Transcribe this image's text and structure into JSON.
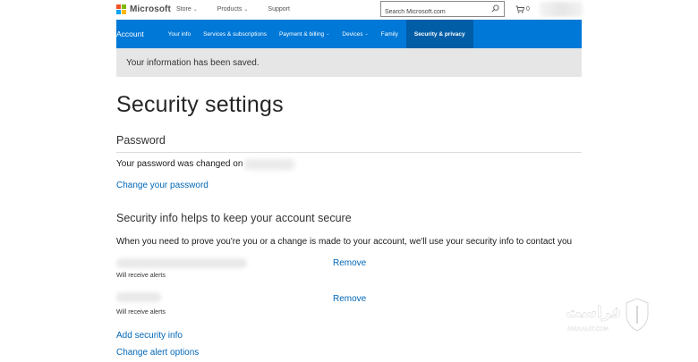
{
  "header": {
    "logo_text": "Microsoft",
    "nav": [
      {
        "label": "Store",
        "has_dropdown": true
      },
      {
        "label": "Products",
        "has_dropdown": true
      },
      {
        "label": "Support",
        "has_dropdown": false
      }
    ],
    "search": {
      "placeholder": "Search Microsoft.com"
    },
    "cart_count": "0"
  },
  "account_nav": {
    "brand": "Account",
    "items": [
      {
        "label": "Your info",
        "has_dropdown": false
      },
      {
        "label": "Services & subscriptions",
        "has_dropdown": false
      },
      {
        "label": "Payment & billing",
        "has_dropdown": true
      },
      {
        "label": "Devices",
        "has_dropdown": true
      },
      {
        "label": "Family",
        "has_dropdown": false
      },
      {
        "label": "Security & privacy",
        "has_dropdown": false,
        "active": true
      }
    ]
  },
  "notice": {
    "text": "Your information has been saved."
  },
  "page": {
    "title": "Security settings",
    "password": {
      "heading": "Password",
      "changed_text": "Your password was changed on",
      "change_link": "Change your password"
    },
    "security_info": {
      "heading": "Security info helps to keep your account secure",
      "description": "When you need to prove you're you or a change is made to your account, we'll use your security info to contact you",
      "entries": [
        {
          "status": "Will receive alerts",
          "action": "Remove"
        },
        {
          "status": "Will receive alerts",
          "action": "Remove"
        }
      ],
      "add_link": "Add security info",
      "alert_options_link": "Change alert options"
    }
  },
  "watermark": {
    "text": "فراست",
    "subtext": "FARAASAT.COM"
  },
  "colors": {
    "accent_blue": "#0078d7",
    "active_tab": "#005da6",
    "link": "#0067b8",
    "notice_bg": "#e6e6e6"
  }
}
